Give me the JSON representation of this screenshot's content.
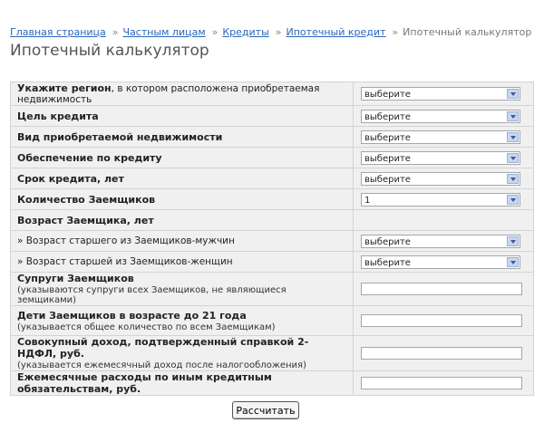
{
  "breadcrumb": {
    "items": [
      "Главная страница",
      "Частным лицам",
      "Кредиты",
      "Ипотечный кредит"
    ],
    "current": "Ипотечный калькулятор",
    "separator": "»"
  },
  "page_title": "Ипотечный калькулятор",
  "form": {
    "region": {
      "label_bold": "Укажите регион",
      "label_rest": ", в котором расположена приобретаемая недвижимость",
      "value": "выберите"
    },
    "purpose": {
      "label": "Цель кредита",
      "value": "выберите"
    },
    "property_type": {
      "label": "Вид приобретаемой недвижимости",
      "value": "выберите"
    },
    "collateral": {
      "label": "Обеспечение по кредиту",
      "value": "выберите"
    },
    "term": {
      "label": "Срок кредита, лет",
      "value": "выберите"
    },
    "borrowers_count": {
      "label": "Количество Заемщиков",
      "value": "1"
    },
    "age_header": {
      "label": "Возраст Заемщика, лет"
    },
    "age_male": {
      "label": "» Возраст старшего из Заемщиков-мужчин",
      "value": "выберите"
    },
    "age_female": {
      "label": "» Возраст старшей из Заемщиков-женщин",
      "value": "выберите"
    },
    "spouses": {
      "label": "Супруги Заемщиков",
      "note": "(указываются супруги всех Заемщиков, не являющиеся земщиками)",
      "value": ""
    },
    "children": {
      "label": "Дети Заемщиков в возрасте до 21 года",
      "note": "(указывается общее количество по всем Заемщикам)",
      "value": ""
    },
    "income": {
      "label": "Совокупный доход, подтвержденный справкой 2-НДФЛ, руб.",
      "note": "(указывается ежемесячный доход после налогообложения)",
      "value": ""
    },
    "expenses": {
      "label": "Ежемесячные расходы по иным кредитным обязательствам, руб.",
      "value": ""
    }
  },
  "submit_label": "Рассчитать"
}
